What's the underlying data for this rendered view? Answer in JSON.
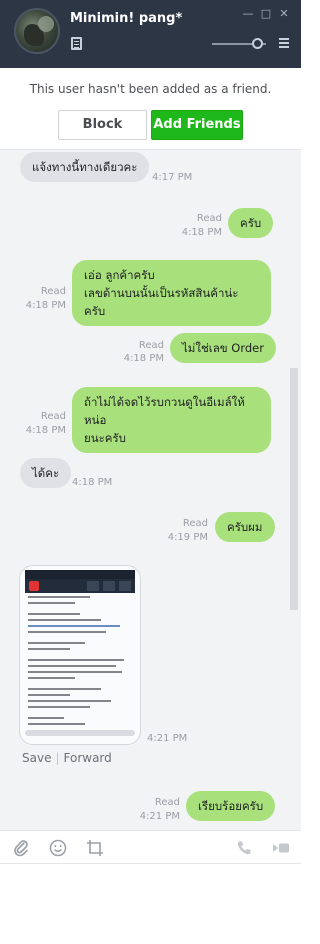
{
  "header": {
    "contact_name": "Minimin! pang*",
    "minimize_glyph": "—",
    "maximize_glyph": "□",
    "close_glyph": "✕"
  },
  "notice": {
    "text": "This user hasn't been added as a friend.",
    "block_label": "Block",
    "add_label": "Add Friends"
  },
  "messages": {
    "m1": {
      "text": "แจ้งทางนี้ทางเดียวคะ",
      "time": "4:17 PM"
    },
    "m2": {
      "text": "ครับ",
      "read": "Read",
      "time": "4:18 PM"
    },
    "m3": {
      "line1": "เอ่อ ลูกค้าครับ",
      "line2": "เลขด้านบนนั้นเป็นรหัสสินค้าน่ะครับ",
      "read": "Read",
      "time": "4:18 PM"
    },
    "m4": {
      "text": "ไม่ใช่เลข Order",
      "read": "Read",
      "time": "4:18 PM"
    },
    "m5": {
      "line1": "ถ้าไม่ได้จดไว้รบกวนดูในอีเมล์ให้หน่อ",
      "line2": "ยนะครับ",
      "read": "Read",
      "time": "4:18 PM"
    },
    "m6": {
      "text": "ได้คะ",
      "time": "4:18 PM"
    },
    "m7": {
      "text": "ครับผม",
      "read": "Read",
      "time": "4:19 PM"
    },
    "m8": {
      "time": "4:21 PM",
      "save_label": "Save",
      "forward_label": "Forward"
    },
    "m9": {
      "text": "เรียบร้อยครับ",
      "read": "Read",
      "time": "4:21 PM"
    }
  },
  "toolbar": {
    "attach_icon": "paperclip-icon",
    "emoji_icon": "smiley-icon",
    "capture_icon": "crop-icon",
    "call_icon": "phone-icon",
    "video_icon": "video-camera-icon"
  },
  "colors": {
    "header_bg": "#2c3645",
    "add_friend_green": "#1fb81a",
    "own_bubble": "#a8e17c",
    "other_bubble": "#dfe1e6",
    "chat_bg": "#f2f3f5"
  }
}
